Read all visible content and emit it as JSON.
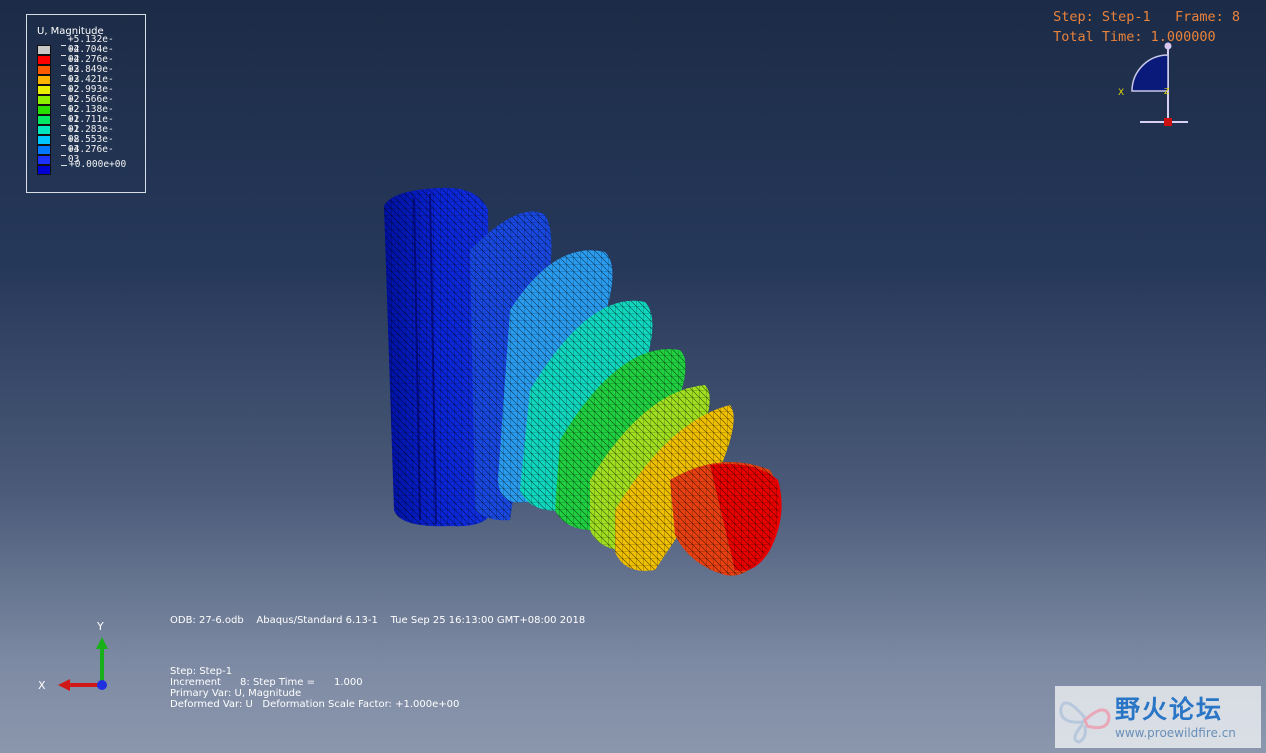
{
  "legend": {
    "title": "U, Magnitude",
    "entries": [
      {
        "label": "+5.132e-02",
        "color": "#c8c8c8"
      },
      {
        "label": "+4.704e-02",
        "color": "#ff0000"
      },
      {
        "label": "+4.276e-02",
        "color": "#ff5a00"
      },
      {
        "label": "+3.849e-02",
        "color": "#ffb400"
      },
      {
        "label": "+3.421e-02",
        "color": "#e8f000"
      },
      {
        "label": "+2.993e-02",
        "color": "#8cf000"
      },
      {
        "label": "+2.566e-02",
        "color": "#28e000"
      },
      {
        "label": "+2.138e-02",
        "color": "#00e864"
      },
      {
        "label": "+1.711e-02",
        "color": "#00e6be"
      },
      {
        "label": "+1.283e-02",
        "color": "#00c8ff"
      },
      {
        "label": "+8.553e-03",
        "color": "#0078ff"
      },
      {
        "label": "+4.276e-03",
        "color": "#1e32ff"
      },
      {
        "label": "+0.000e+00",
        "color": "#0000d0"
      }
    ]
  },
  "step_info": {
    "step_line": "Step: Step-1   Frame: 8",
    "time_line": "Total Time: 1.000000"
  },
  "orientation_labels": {
    "x": "X",
    "z": "Z"
  },
  "odb_line": "ODB: 27-6.odb    Abaqus/Standard 6.13-1    Tue Sep 25 16:13:00 GMT+08:00 2018",
  "status": {
    "step": "Step: Step-1",
    "increment": "Increment      8: Step Time =      1.000",
    "primary_var": "Primary Var: U, Magnitude",
    "deformed_var": "Deformed Var: U   Deformation Scale Factor: +1.000e+00"
  },
  "triad": {
    "x_label": "X",
    "y_label": "Y",
    "x_color": "#d01818",
    "y_color": "#18b018",
    "z_color": "#2030e0"
  },
  "watermark": {
    "title": "野火论坛",
    "url": "www.proewildfire.cn"
  },
  "accent": "#e9823a"
}
